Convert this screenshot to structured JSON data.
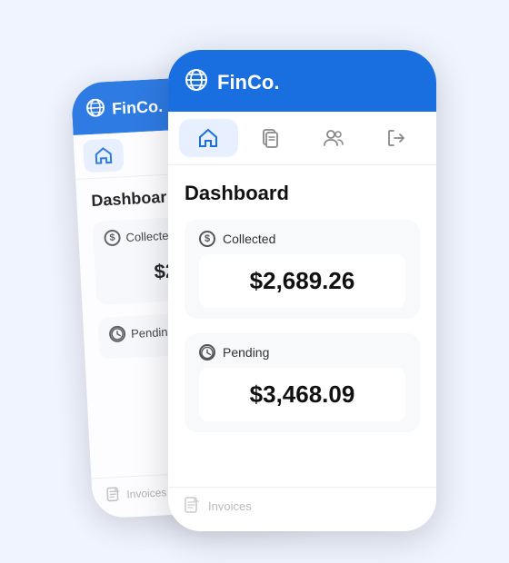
{
  "app": {
    "name": "FinCo.",
    "logo_label": "FinCo."
  },
  "nav": {
    "tabs": [
      {
        "id": "home",
        "label": "Home",
        "active": true
      },
      {
        "id": "documents",
        "label": "Documents",
        "active": false
      },
      {
        "id": "users",
        "label": "Users",
        "active": false
      },
      {
        "id": "logout",
        "label": "Logout",
        "active": false
      }
    ]
  },
  "dashboard": {
    "title": "Dashboard",
    "collected": {
      "label": "Collected",
      "value": "$2,689.26"
    },
    "pending": {
      "label": "Pending",
      "value": "$3,468.09"
    },
    "invoices_label": "Invoices"
  }
}
